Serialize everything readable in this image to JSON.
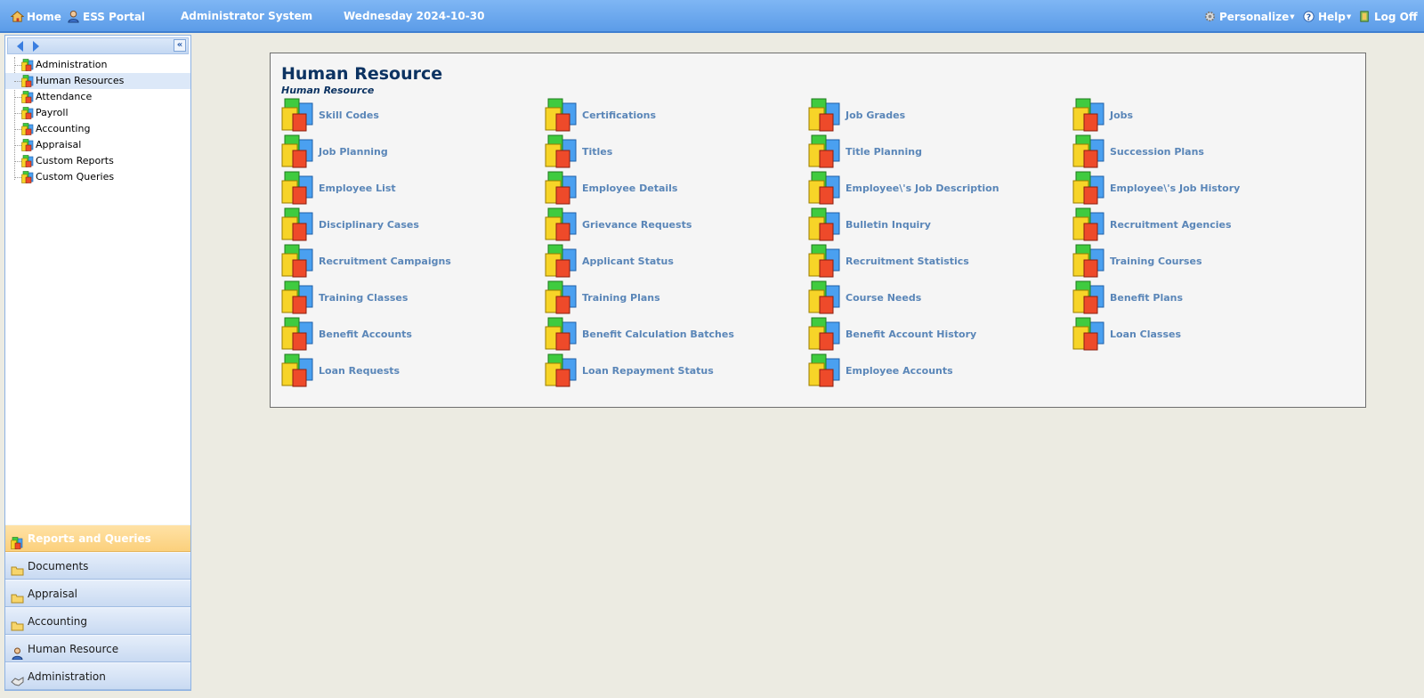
{
  "topbar": {
    "home": "Home",
    "ess_portal": "ESS Portal",
    "system_name": "Administrator System",
    "date": "Wednesday 2024-10-30",
    "personalize": "Personalize",
    "help": "Help",
    "logoff": "Log Off"
  },
  "tree": {
    "items": [
      {
        "label": "Administration"
      },
      {
        "label": "Human Resources",
        "selected": true
      },
      {
        "label": "Attendance"
      },
      {
        "label": "Payroll"
      },
      {
        "label": "Accounting"
      },
      {
        "label": "Appraisal"
      },
      {
        "label": "Custom Reports"
      },
      {
        "label": "Custom Queries"
      }
    ]
  },
  "accordion": {
    "items": [
      {
        "label": "Reports and Queries",
        "icon": "reports-icon",
        "active": true
      },
      {
        "label": "Documents",
        "icon": "folder-icon"
      },
      {
        "label": "Appraisal",
        "icon": "folder-icon"
      },
      {
        "label": "Accounting",
        "icon": "folder-icon"
      },
      {
        "label": "Human Resource",
        "icon": "user-icon"
      },
      {
        "label": "Administration",
        "icon": "handshake-icon"
      }
    ]
  },
  "panel": {
    "title": "Human Resource",
    "subtitle": "Human Resource",
    "items": [
      "Skill Codes",
      "Certifications",
      "Job Grades",
      "Jobs",
      "Job Planning",
      "Titles",
      "Title Planning",
      "Succession Plans",
      "Employee List",
      "Employee Details",
      "Employee\\'s Job Description",
      "Employee\\'s Job History",
      "Disciplinary Cases",
      "Grievance Requests",
      "Bulletin Inquiry",
      "Recruitment Agencies",
      "Recruitment Campaigns",
      "Applicant Status",
      "Recruitment Statistics",
      "Training Courses",
      "Training Classes",
      "Training Plans",
      "Course Needs",
      "Benefit Plans",
      "Benefit Accounts",
      "Benefit Calculation Batches",
      "Benefit Account History",
      "Loan Classes",
      "Loan Requests",
      "Loan Repayment Status",
      "Employee Accounts"
    ]
  },
  "colors": {
    "topbar": "#6aa7ef",
    "link": "#5a86b8",
    "title": "#0c3362",
    "accordion_active": "#fbd07c"
  }
}
